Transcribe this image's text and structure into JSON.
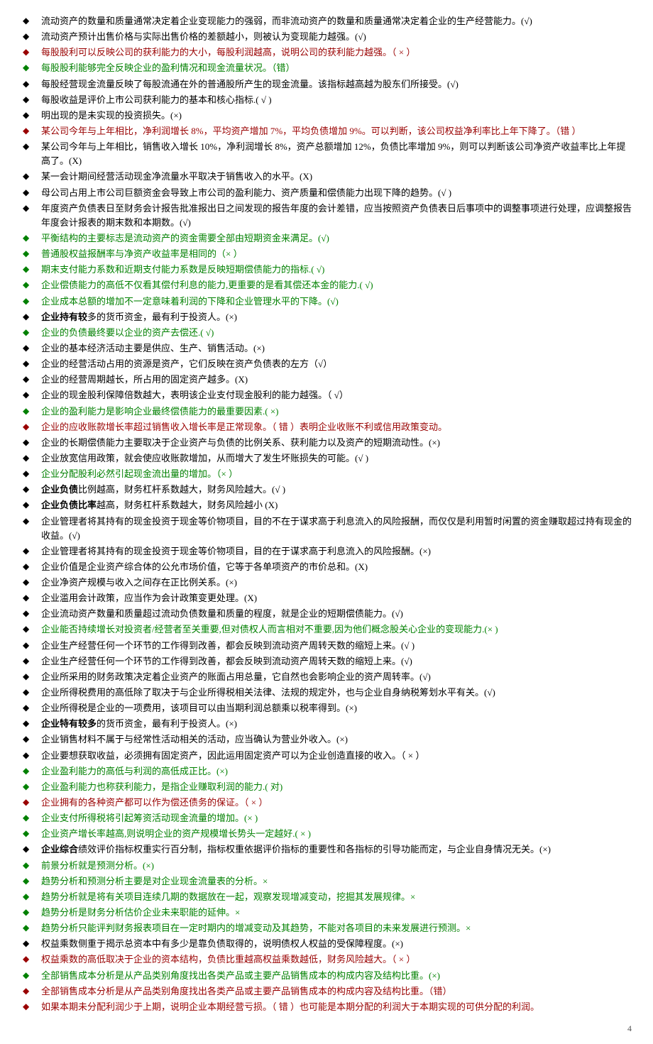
{
  "pageNumber": "4",
  "items": [
    {
      "bulletColor": "black",
      "textColor": "black",
      "text": "流动资产的数量和质量通常决定着企业变现能力的强弱，而非流动资产的数量和质量通常决定着企业的生产经营能力。(√)"
    },
    {
      "bulletColor": "black",
      "textColor": "black",
      "text": "流动资产预计出售价格与实际出售价格的差额越小，则被认为变现能力越强。(√)"
    },
    {
      "bulletColor": "darkred",
      "textColor": "darkred",
      "text": "每股股利可以反映公司的获利能力的大小，每股利润越高，说明公司的获利能力越强。（ ×  ）"
    },
    {
      "bulletColor": "green",
      "textColor": "green",
      "text": "每股股利能够完全反映企业的盈利情况和现金流量状况。（错）"
    },
    {
      "bulletColor": "black",
      "textColor": "black",
      "text": "每股经营现金流量反映了每股流通在外的普通股所产生的现金流量。该指标越高越为股东们所接受。(√)"
    },
    {
      "bulletColor": "black",
      "textColor": "black",
      "text": "每股收益是评价上市公司获利能力的基本和核心指标.(  √  )"
    },
    {
      "bulletColor": "black",
      "textColor": "black",
      "text": "明出现的是未实现的投资损失。(×)"
    },
    {
      "bulletColor": "darkred",
      "textColor": "darkred",
      "text": "某公司今年与上年相比，净利润增长 8%，平均资产增加 7%，平均负债增加 9%。可以判断，该公司权益净利率比上年下降了。（错 ）"
    },
    {
      "bulletColor": "black",
      "textColor": "black",
      "text": "某公司今年与上年相比，销售收入增长 10%，净利润增长 8%，资产总额增加 12%，负债比率增加 9%，则可以判断该公司净资产收益率比上年提高了。(X)"
    },
    {
      "bulletColor": "black",
      "textColor": "black",
      "text": "某一会计期间经营活动现金净流量水平取决于销售收入的水平。(X)"
    },
    {
      "bulletColor": "black",
      "textColor": "black",
      "text": "母公司占用上市公司巨额资金会导致上市公司的盈利能力、资产质量和偿债能力出现下降的趋势。(√  )"
    },
    {
      "bulletColor": "black",
      "textColor": "black",
      "text": "年度资产负债表日至财务会计报告批准报出日之间发现的报告年度的会计差错，应当按照资产负债表日后事项中的调整事项进行处理，应调整报告年度会计报表的期末数和本期数。(√)"
    },
    {
      "bulletColor": "green",
      "textColor": "green",
      "text": "平衡结构的主要标志是流动资产的资金需要全部由短期资金来满足。(√)"
    },
    {
      "bulletColor": "green",
      "textColor": "green",
      "text": "普通股权益报酬率与净资产收益率是相同的（× ）"
    },
    {
      "bulletColor": "green",
      "textColor": "green",
      "text": "期末支付能力系数和近期支付能力系数是反映短期偿债能力的指标.(  √)"
    },
    {
      "bulletColor": "green",
      "textColor": "green",
      "text": "企业偿债能力的高低不仅看其偿付利息的能力,更重要的是看其偿还本金的能力.(  √)"
    },
    {
      "bulletColor": "green",
      "textColor": "green",
      "text": "企业成本总额的增加不一定意味着利润的下降和企业管理水平的下降。(√)"
    },
    {
      "bulletColor": "black",
      "textColor": "black",
      "text": "<b>企业持有较</b>多的货币资金，最有利于投资人。(×)"
    },
    {
      "bulletColor": "green",
      "textColor": "green",
      "text": "企业的负债最终要以企业的资产去偿还.(  √)"
    },
    {
      "bulletColor": "black",
      "textColor": "black",
      "text": "企业的基本经济活动主要是供应、生产、销售活动。(×)"
    },
    {
      "bulletColor": "black",
      "textColor": "black",
      "text": "企业的经营活动占用的资源是资产，它们反映在资产负债表的左方（√）"
    },
    {
      "bulletColor": "black",
      "textColor": "black",
      "text": "企业的经营周期越长，所占用的固定资产越多。(X)"
    },
    {
      "bulletColor": "black",
      "textColor": "black",
      "text": "企业的现金股利保障倍数越大，表明该企业支付现金股利的能力越强。（   √）"
    },
    {
      "bulletColor": "green",
      "textColor": "green",
      "text": "企业的盈利能力是影响企业最终偿债能力的最重要因素.(  ×)"
    },
    {
      "bulletColor": "darkred",
      "textColor": "darkred",
      "text": "企业的应收账款增长率超过销售收入增长率是正常现象。（ 错  ）表明企业收账不利或信用政策变动。"
    },
    {
      "bulletColor": "black",
      "textColor": "black",
      "text": "企业的长期偿债能力主要取决于企业资产与负债的比例关系、获利能力以及资产的短期流动性。(×)"
    },
    {
      "bulletColor": "black",
      "textColor": "black",
      "text": "企业放宽信用政策，就会使应收账款增加，从而增大了发生坏账损失的可能。(√  )"
    },
    {
      "bulletColor": "black",
      "textColor": "green",
      "text": "企业分配股利必然引起现金流出量的增加。（× ）"
    },
    {
      "bulletColor": "black",
      "textColor": "black",
      "text": "<b>企业负债</b>比例越高，财务杠杆系数越大，财务风险越大。(√  )"
    },
    {
      "bulletColor": "black",
      "textColor": "black",
      "text": "<b>企业负债比率</b>越高，财务杠杆系数越大，财务风险越小  (X)"
    },
    {
      "bulletColor": "black",
      "textColor": "black",
      "text": "企业管理者将其持有的现金投资于现金等价物项目，目的不在于谋求高于利息流入的风险报酬，而仅仅是利用暂时闲置的资金赚取超过持有现金的收益。(√)"
    },
    {
      "bulletColor": "black",
      "textColor": "black",
      "text": "企业管理者将其持有的现金投资于现金等价物项目，目的在于谋求高于利息流入的风险报酬。(×)"
    },
    {
      "bulletColor": "black",
      "textColor": "black",
      "text": "企业价值是企业资产综合体的公允市场价值，它等于各单项资产的市价总和。(X)"
    },
    {
      "bulletColor": "black",
      "textColor": "black",
      "text": "企业净资产规模与收入之间存在正比例关系。(×)"
    },
    {
      "bulletColor": "black",
      "textColor": "black",
      "text": "企业滥用会计政策，应当作为会计政策变更处理。(X)"
    },
    {
      "bulletColor": "black",
      "textColor": "black",
      "text": "企业流动资产数量和质量超过流动负债数量和质量的程度，就是企业的短期偿债能力。(√)"
    },
    {
      "bulletColor": "black",
      "textColor": "green",
      "text": "企业能否持续增长对投资者/经营者至关重要,但对债权人而言相对不重要,因为他们概念股关心企业的变现能力.(×   )"
    },
    {
      "bulletColor": "black",
      "textColor": "black",
      "text": "企业生产经营任何一个环节的工作得到改善，都会反映到流动资产周转天数的缩短上来。(√  )"
    },
    {
      "bulletColor": "black",
      "textColor": "black",
      "text": "企业生产经营任何一个环节的工作得到改善，都会反映到流动资产周转天数的缩短上来。(√)"
    },
    {
      "bulletColor": "black",
      "textColor": "black",
      "text": "企业所采用的财务政策决定着企业资产的账面占用总量，它自然也会影响企业的资产周转率。(√)"
    },
    {
      "bulletColor": "black",
      "textColor": "black",
      "text": "企业所得税费用的高低除了取决于与企业所得税相关法律、法规的规定外，也与企业自身纳税筹划水平有关。(√)"
    },
    {
      "bulletColor": "black",
      "textColor": "black",
      "text": "企业所得税是企业的一项费用，该项目可以由当期利润总额乘以税率得到。(×)"
    },
    {
      "bulletColor": "black",
      "textColor": "black",
      "text": "<b>企业特有较多</b>的货币资金，最有利于投资人。(×)"
    },
    {
      "bulletColor": "black",
      "textColor": "black",
      "text": "企业销售材料不属于与经常性活动相关的活动，应当确认为营业外收入。(×)"
    },
    {
      "bulletColor": "black",
      "textColor": "black",
      "text": "企业要想获取收益，必须拥有固定资产，因此运用固定资产可以为企业创造直接的收入。（ × ）"
    },
    {
      "bulletColor": "green",
      "textColor": "green",
      "text": "企业盈利能力的高低与利润的高低成正比。(×)"
    },
    {
      "bulletColor": "green",
      "textColor": "green",
      "text": "企业盈利能力也称获利能力，是指企业赚取利润的能力.(   对)"
    },
    {
      "bulletColor": "darkred",
      "textColor": "darkred",
      "text": "企业拥有的各种资产都可以作为偿还债务的保证。（  ×  ）"
    },
    {
      "bulletColor": "green",
      "textColor": "green",
      "text": "企业支付所得税将引起筹资活动现金流量的增加。(× )"
    },
    {
      "bulletColor": "green",
      "textColor": "green",
      "text": "企业资产增长率越高,则说明企业的资产规模增长势头一定越好.(   ×  )"
    },
    {
      "bulletColor": "black",
      "textColor": "black",
      "text": "<b>企业综合</b>绩效评价指标权重实行百分制，指标权重依据评价指标的重要性和各指标的引导功能而定，与企业自身情况无关。(×)"
    },
    {
      "bulletColor": "green",
      "textColor": "green",
      "text": "前景分析就是预测分析。(×)"
    },
    {
      "bulletColor": "green",
      "textColor": "green",
      "text": "趋势分析和预测分析主要是对企业现金流量表的分析。×"
    },
    {
      "bulletColor": "green",
      "textColor": "green",
      "text": "趋势分析就是将有关项目连续几期的数据放在一起，观察发现增减变动，挖掘其发展规律。×"
    },
    {
      "bulletColor": "green",
      "textColor": "green",
      "text": "趋势分析是财务分析估价企业未来职能的延伸。×"
    },
    {
      "bulletColor": "green",
      "textColor": "green",
      "text": "趋势分析只能评判财务报表项目在一定时期内的增减变动及其趋势，不能对各项目的未来发展进行预测。×"
    },
    {
      "bulletColor": "black",
      "textColor": "black",
      "text": "权益乘数侧重于揭示总资本中有多少是靠负债取得的，说明债权人权益的受保障程度。(×)"
    },
    {
      "bulletColor": "darkred",
      "textColor": "darkred",
      "text": "权益乘数的高低取决于企业的资本结构，负债比重越高权益乘数越低，财务风险越大。（  ×  ）"
    },
    {
      "bulletColor": "green",
      "textColor": "green",
      "text": "全部销售成本分析是从产品类别角度找出各类产品或主要产品销售成本的构成内容及结构比重。(×)"
    },
    {
      "bulletColor": "darkred",
      "textColor": "darkred",
      "text": "全部销售成本分析是从产品类别角度找出各类产品或主要产品销售成本的构成内容及结构比重。（错）"
    },
    {
      "bulletColor": "darkred",
      "textColor": "darkred",
      "text": "如果本期未分配利润少于上期，说明企业本期经营亏损。（ 错 ）也可能是本期分配的利润大于本期实现的可供分配的利润。"
    }
  ]
}
